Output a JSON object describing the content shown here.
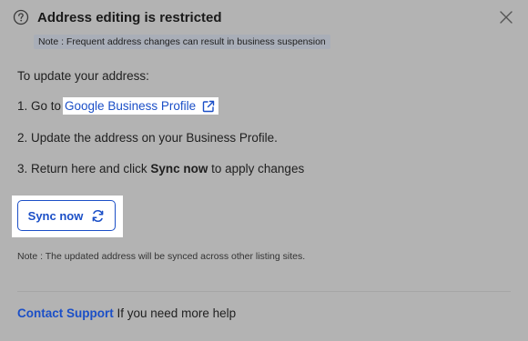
{
  "dialog": {
    "title": "Address editing is restricted",
    "note_banner": "Note : Frequent address changes can result in business suspension",
    "intro": "To update your address:",
    "step1_prefix": "1. Go to",
    "step1_link": "Google Business Profile",
    "step2": "2. Update the address on your Business Profile.",
    "step3_prefix": "3. Return here and click",
    "step3_bold": "Sync now",
    "step3_suffix": "to apply changes",
    "sync_button": "Sync now",
    "bottom_note": "Note : The updated address will be synced across other listing sites.",
    "support_link": "Contact Support",
    "support_suffix": "If you need more help"
  },
  "colors": {
    "overlay_background": "#b3b3b3",
    "link_blue": "#1b4fc7",
    "note_banner_bg": "#a9aeb8"
  },
  "icons": {
    "header": "help-circle-icon",
    "close": "close-icon",
    "external": "external-link-icon",
    "sync": "refresh-icon"
  }
}
